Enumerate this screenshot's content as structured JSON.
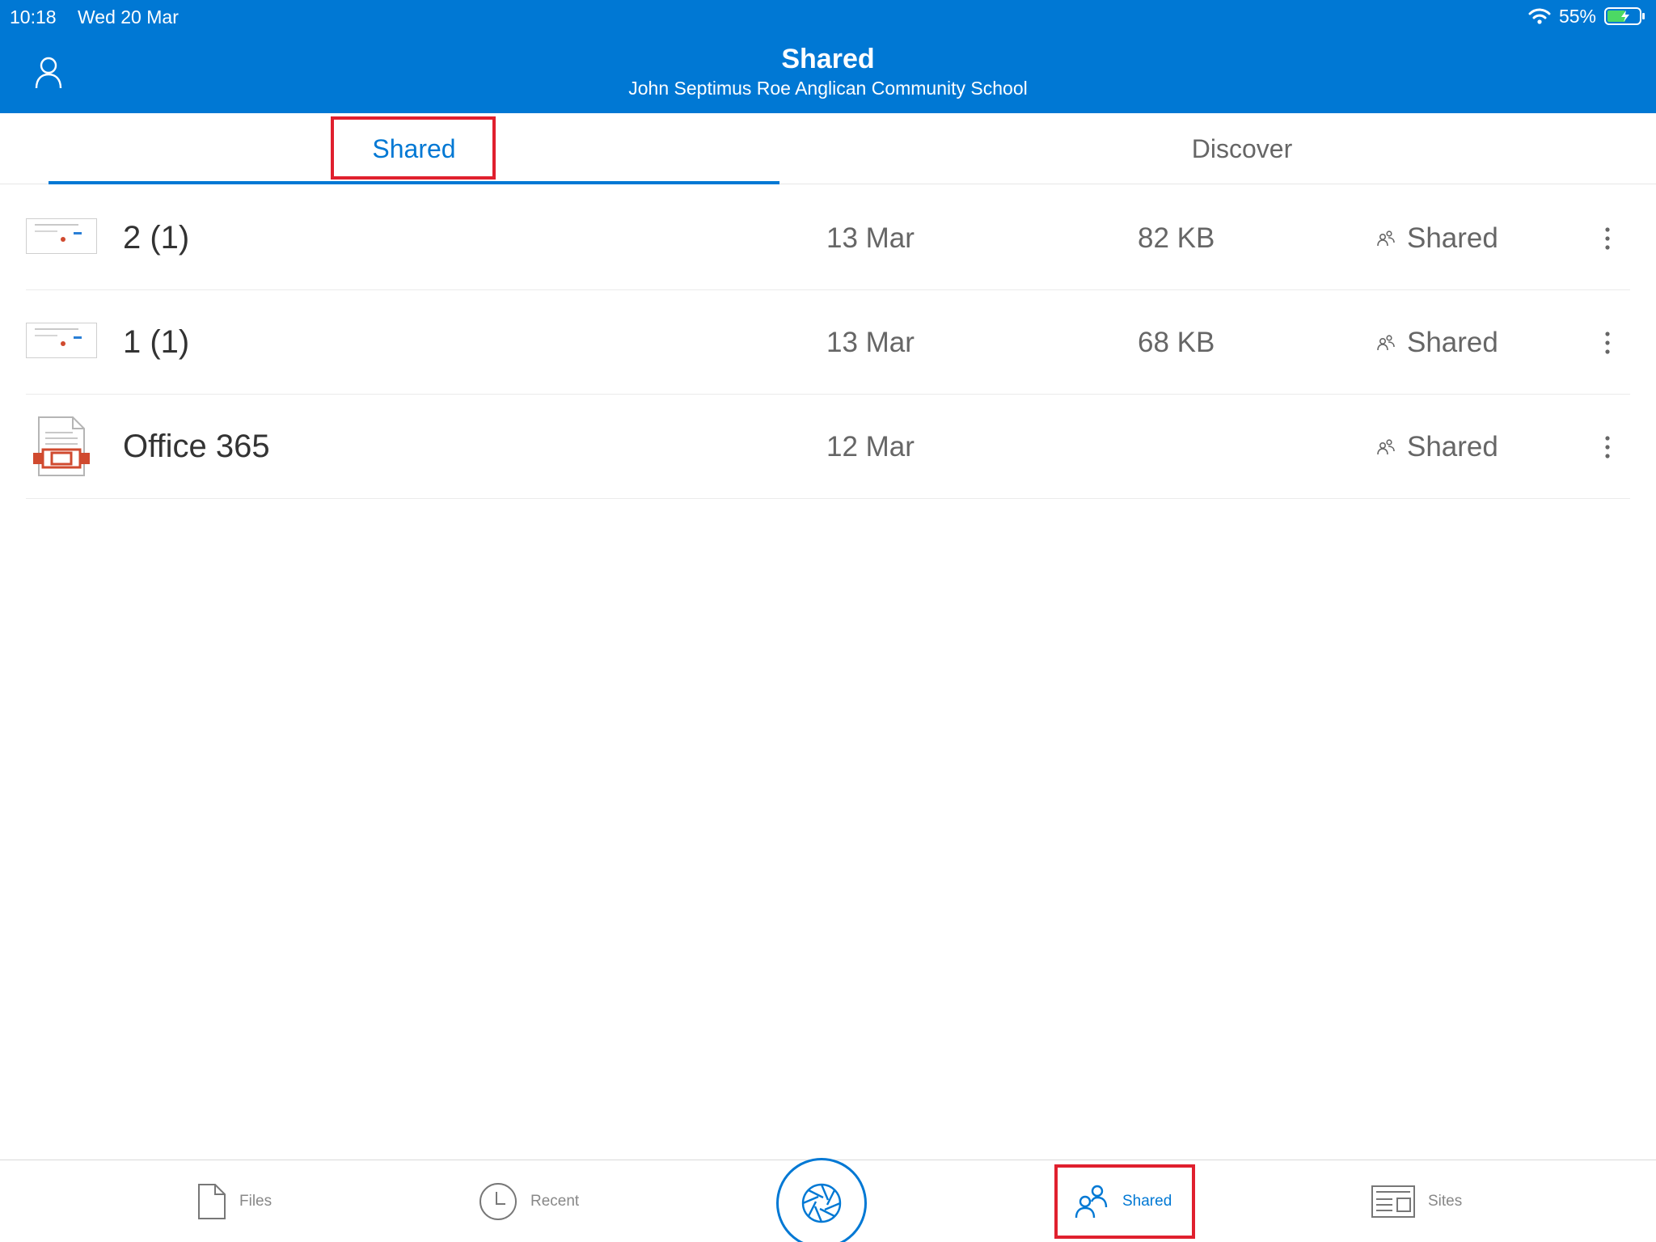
{
  "status_bar": {
    "time": "10:18",
    "date": "Wed 20 Mar",
    "battery": "55%"
  },
  "header": {
    "title": "Shared",
    "subtitle": "John Septimus Roe Anglican Community School"
  },
  "tabs": [
    {
      "label": "Shared",
      "active": true
    },
    {
      "label": "Discover",
      "active": false
    }
  ],
  "files": [
    {
      "name": "2 (1)",
      "date": "13 Mar",
      "size": "82 KB",
      "sharing": "Shared",
      "icon": "image-thumbnail"
    },
    {
      "name": "1 (1)",
      "date": "13 Mar",
      "size": "68 KB",
      "sharing": "Shared",
      "icon": "image-thumbnail"
    },
    {
      "name": "Office 365",
      "date": "12 Mar",
      "size": "",
      "sharing": "Shared",
      "icon": "powerpoint-file-icon"
    }
  ],
  "bottom_nav": [
    {
      "label": "Files",
      "icon": "file-icon"
    },
    {
      "label": "Recent",
      "icon": "clock-icon"
    },
    {
      "label": "Shared",
      "icon": "people-icon",
      "active": true
    },
    {
      "label": "Sites",
      "icon": "sites-icon"
    }
  ],
  "colors": {
    "accent": "#0078d4",
    "highlight": "#e0202e"
  }
}
